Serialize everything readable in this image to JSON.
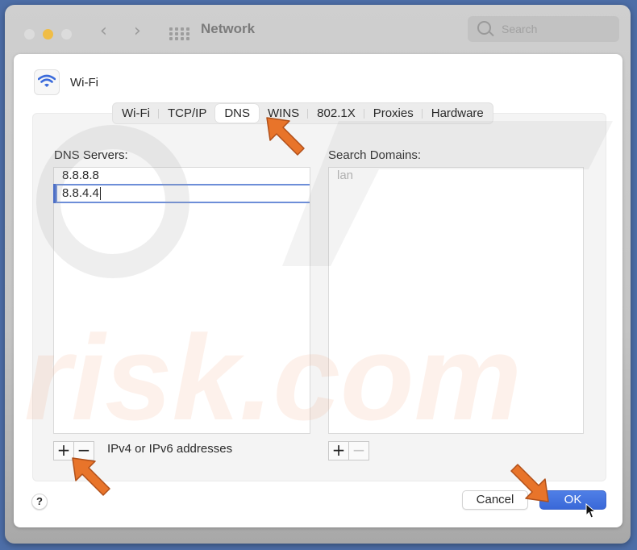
{
  "window": {
    "title": "Network",
    "search_placeholder": "Search",
    "nav_back": "‹",
    "nav_forward": "›"
  },
  "sheet": {
    "service_name": "Wi-Fi",
    "service_icon": "wifi-icon",
    "tabs": [
      {
        "label": "Wi-Fi",
        "active": false
      },
      {
        "label": "TCP/IP",
        "active": false
      },
      {
        "label": "DNS",
        "active": true
      },
      {
        "label": "WINS",
        "active": false
      },
      {
        "label": "802.1X",
        "active": false
      },
      {
        "label": "Proxies",
        "active": false
      },
      {
        "label": "Hardware",
        "active": false
      }
    ],
    "dns_servers": {
      "label": "DNS Servers:",
      "entries": [
        "8.8.8.8",
        "8.8.4.4"
      ],
      "editing_index": 1,
      "add_label": "+",
      "remove_label": "−",
      "hint": "IPv4 or IPv6 addresses"
    },
    "search_domains": {
      "label": "Search Domains:",
      "placeholder": "lan",
      "add_label": "+",
      "remove_label": "−"
    },
    "help_label": "?",
    "cancel_label": "Cancel",
    "ok_label": "OK"
  },
  "annotations": {
    "arrow_color": "#e8742a",
    "watermark_text": "PC risk.com"
  },
  "colors": {
    "accent": "#3b6bdb",
    "traffic_light_active": "#f0bd46"
  }
}
